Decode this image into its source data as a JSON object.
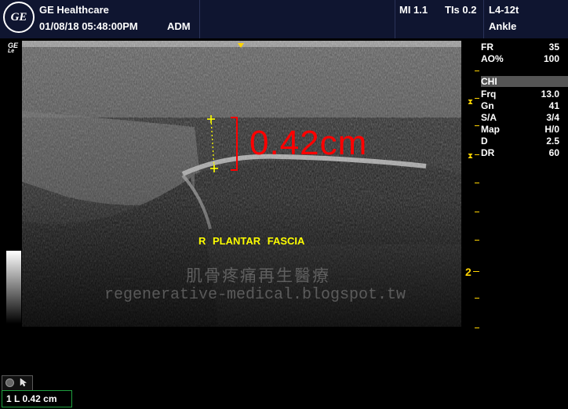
{
  "header": {
    "brand": "GE Healthcare",
    "datetime": "01/08/18 05:48:00PM",
    "operator": "ADM",
    "mi": "MI 1.1",
    "tis": "TIs 0.2",
    "probe": "L4-12t",
    "preset": "Ankle",
    "logo_text": "GE"
  },
  "params": [
    {
      "k": "FR",
      "v": "35"
    },
    {
      "k": "AO%",
      "v": "100"
    }
  ],
  "chi_label": "CHI",
  "params2": [
    {
      "k": "Frq",
      "v": "13.0"
    },
    {
      "k": "Gn",
      "v": "41"
    },
    {
      "k": "S/A",
      "v": "3/4"
    },
    {
      "k": "Map",
      "v": "H/0"
    },
    {
      "k": "D",
      "v": "2.5"
    },
    {
      "k": "DR",
      "v": "60"
    }
  ],
  "depth_label": "2",
  "measurement_overlay": "0.42cm",
  "annotation": "R PLANTAR FASCIA",
  "watermark_cn": "肌骨疼痛再生醫療",
  "watermark_url": "regenerative-medical.blogspot.tw",
  "measure_result": "1 L 0.42 cm",
  "ge_small": "GE",
  "ge_small2": "Le",
  "colors": {
    "header_bg": "#0f1530",
    "caliper": "#ffff00",
    "measure": "#ff0000",
    "focus": "#ffd400",
    "result_border": "#1fa03f"
  },
  "icons": [
    "circle-button-icon",
    "cursor-icon",
    "focus-marker-icon"
  ]
}
